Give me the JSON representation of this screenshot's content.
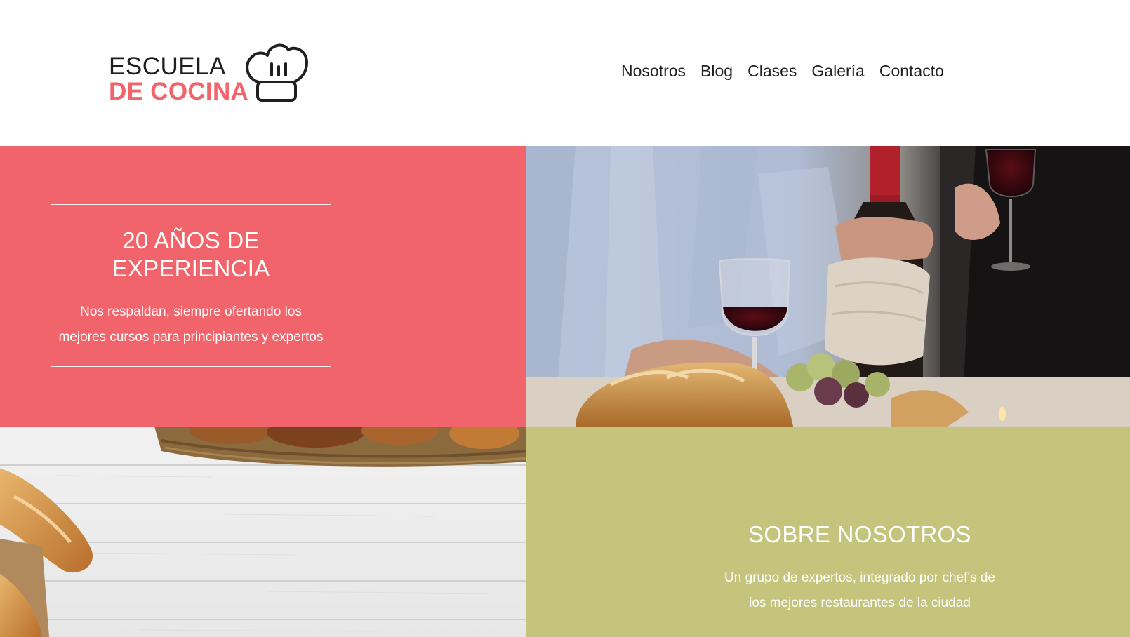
{
  "brand": {
    "line1": "ESCUELA",
    "line2": "DE COCINA",
    "accent_color": "#f2646b",
    "dark_color": "#1f1f1f"
  },
  "nav": {
    "items": [
      "Nosotros",
      "Blog",
      "Clases",
      "Galería",
      "Contacto"
    ]
  },
  "experience": {
    "title_line1": "20 AÑOS DE",
    "title_line2": "EXPERIENCIA",
    "text_line1": "Nos respaldan, siempre ofertando los",
    "text_line2": "mejores cursos para principiantes y expertos",
    "bg_color": "#f2646b"
  },
  "about": {
    "title": "SOBRE NOSOTROS",
    "text_line1": "Un grupo de expertos, integrado por chef's de",
    "text_line2": "los mejores restaurantes de la ciudad",
    "bg_color": "#c5c47c"
  },
  "images": {
    "wine": "wine-dinner-photo",
    "bread": "bread-table-photo"
  }
}
